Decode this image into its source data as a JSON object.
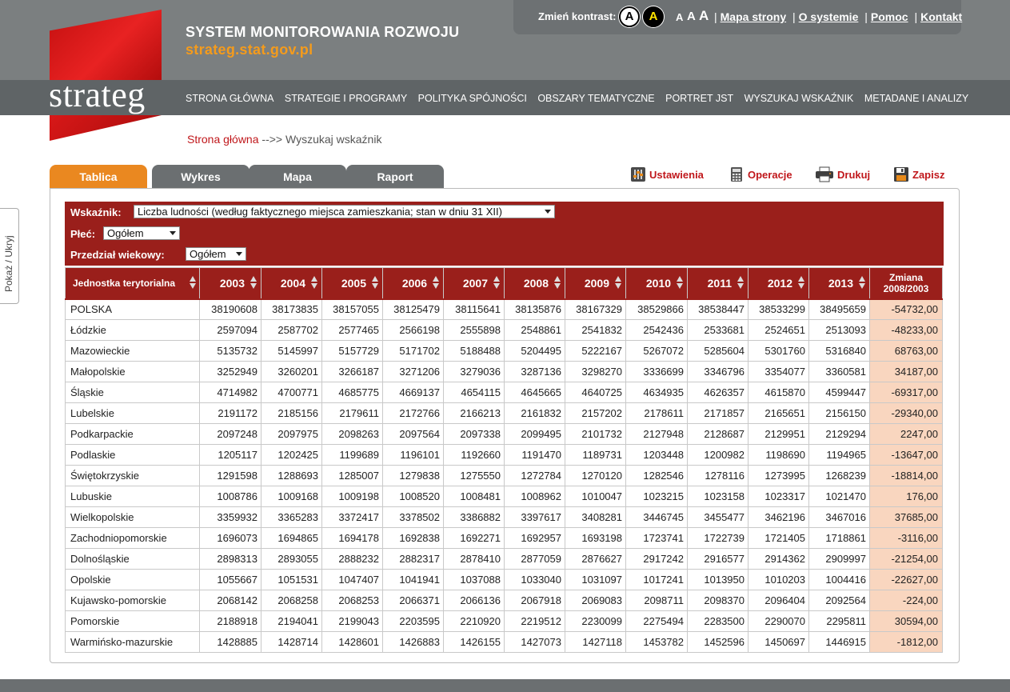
{
  "header": {
    "site_title": "SYSTEM MONITOROWANIA ROZWOJU",
    "site_url": "strateg.stat.gov.pl",
    "logo_text": "strateg",
    "contrast_label": "Zmień kontrast:",
    "contrast_normal": "A",
    "contrast_high": "A",
    "font_small": "A",
    "font_medium": "A",
    "font_large": "A",
    "links": [
      "Mapa strony",
      "O systemie",
      "Pomoc",
      "Kontakt"
    ],
    "link_separator": "|"
  },
  "nav": {
    "items": [
      "STRONA GŁÓWNA",
      "STRATEGIE I PROGRAMY",
      "POLITYKA SPÓJNOŚCI",
      "OBSZARY TEMATYCZNE",
      "PORTRET JST",
      "WYSZUKAJ WSKAŹNIK",
      "METADANE I ANALIZY"
    ]
  },
  "breadcrumb": {
    "home": "Strona główna",
    "separator": "-->>",
    "current": "Wyszukaj wskaźnik"
  },
  "side_toggle": "Pokaż / Ukryj",
  "tabs": [
    "Tablica",
    "Wykres",
    "Mapa",
    "Raport"
  ],
  "active_tab": "Tablica",
  "actions": {
    "settings": "Ustawienia",
    "operations": "Operacje",
    "print": "Drukuj",
    "save": "Zapisz"
  },
  "filters": {
    "indicator_label": "Wskaźnik:",
    "indicator_value": "Liczba ludności (według faktycznego miejsca zamieszkania; stan w dniu 31 XII)",
    "sex_label": "Płeć:",
    "sex_value": "Ogółem",
    "age_label": "Przedział wiekowy:",
    "age_value": "Ogółem"
  },
  "table": {
    "unit_header": "Jednostka terytorialna",
    "years": [
      "2003",
      "2004",
      "2005",
      "2006",
      "2007",
      "2008",
      "2009",
      "2010",
      "2011",
      "2012",
      "2013"
    ],
    "change_header_line1": "Zmiana",
    "change_header_line2": "2008/2003",
    "rows": [
      {
        "name": "POLSKA",
        "values": [
          "38190608",
          "38173835",
          "38157055",
          "38125479",
          "38115641",
          "38135876",
          "38167329",
          "38529866",
          "38538447",
          "38533299",
          "38495659"
        ],
        "change": "-54732,00"
      },
      {
        "name": "Łódzkie",
        "values": [
          "2597094",
          "2587702",
          "2577465",
          "2566198",
          "2555898",
          "2548861",
          "2541832",
          "2542436",
          "2533681",
          "2524651",
          "2513093"
        ],
        "change": "-48233,00"
      },
      {
        "name": "Mazowieckie",
        "values": [
          "5135732",
          "5145997",
          "5157729",
          "5171702",
          "5188488",
          "5204495",
          "5222167",
          "5267072",
          "5285604",
          "5301760",
          "5316840"
        ],
        "change": "68763,00"
      },
      {
        "name": "Małopolskie",
        "values": [
          "3252949",
          "3260201",
          "3266187",
          "3271206",
          "3279036",
          "3287136",
          "3298270",
          "3336699",
          "3346796",
          "3354077",
          "3360581"
        ],
        "change": "34187,00"
      },
      {
        "name": "Śląskie",
        "values": [
          "4714982",
          "4700771",
          "4685775",
          "4669137",
          "4654115",
          "4645665",
          "4640725",
          "4634935",
          "4626357",
          "4615870",
          "4599447"
        ],
        "change": "-69317,00"
      },
      {
        "name": "Lubelskie",
        "values": [
          "2191172",
          "2185156",
          "2179611",
          "2172766",
          "2166213",
          "2161832",
          "2157202",
          "2178611",
          "2171857",
          "2165651",
          "2156150"
        ],
        "change": "-29340,00"
      },
      {
        "name": "Podkarpackie",
        "values": [
          "2097248",
          "2097975",
          "2098263",
          "2097564",
          "2097338",
          "2099495",
          "2101732",
          "2127948",
          "2128687",
          "2129951",
          "2129294"
        ],
        "change": "2247,00"
      },
      {
        "name": "Podlaskie",
        "values": [
          "1205117",
          "1202425",
          "1199689",
          "1196101",
          "1192660",
          "1191470",
          "1189731",
          "1203448",
          "1200982",
          "1198690",
          "1194965"
        ],
        "change": "-13647,00"
      },
      {
        "name": "Świętokrzyskie",
        "values": [
          "1291598",
          "1288693",
          "1285007",
          "1279838",
          "1275550",
          "1272784",
          "1270120",
          "1282546",
          "1278116",
          "1273995",
          "1268239"
        ],
        "change": "-18814,00"
      },
      {
        "name": "Lubuskie",
        "values": [
          "1008786",
          "1009168",
          "1009198",
          "1008520",
          "1008481",
          "1008962",
          "1010047",
          "1023215",
          "1023158",
          "1023317",
          "1021470"
        ],
        "change": "176,00"
      },
      {
        "name": "Wielkopolskie",
        "values": [
          "3359932",
          "3365283",
          "3372417",
          "3378502",
          "3386882",
          "3397617",
          "3408281",
          "3446745",
          "3455477",
          "3462196",
          "3467016"
        ],
        "change": "37685,00"
      },
      {
        "name": "Zachodniopomorskie",
        "values": [
          "1696073",
          "1694865",
          "1694178",
          "1692838",
          "1692271",
          "1692957",
          "1693198",
          "1723741",
          "1722739",
          "1721405",
          "1718861"
        ],
        "change": "-3116,00"
      },
      {
        "name": "Dolnośląskie",
        "values": [
          "2898313",
          "2893055",
          "2888232",
          "2882317",
          "2878410",
          "2877059",
          "2876627",
          "2917242",
          "2916577",
          "2914362",
          "2909997"
        ],
        "change": "-21254,00"
      },
      {
        "name": "Opolskie",
        "values": [
          "1055667",
          "1051531",
          "1047407",
          "1041941",
          "1037088",
          "1033040",
          "1031097",
          "1017241",
          "1013950",
          "1010203",
          "1004416"
        ],
        "change": "-22627,00"
      },
      {
        "name": "Kujawsko-pomorskie",
        "values": [
          "2068142",
          "2068258",
          "2068253",
          "2066371",
          "2066136",
          "2067918",
          "2069083",
          "2098711",
          "2098370",
          "2096404",
          "2092564"
        ],
        "change": "-224,00"
      },
      {
        "name": "Pomorskie",
        "values": [
          "2188918",
          "2194041",
          "2199043",
          "2203595",
          "2210920",
          "2219512",
          "2230099",
          "2275494",
          "2283500",
          "2290070",
          "2295811"
        ],
        "change": "30594,00"
      },
      {
        "name": "Warmińsko-mazurskie",
        "values": [
          "1428885",
          "1428714",
          "1428601",
          "1426883",
          "1426155",
          "1427073",
          "1427118",
          "1453782",
          "1452596",
          "1450697",
          "1446915"
        ],
        "change": "-1812,00"
      }
    ]
  },
  "colors": {
    "brand_red": "#9a1f1b",
    "accent_orange": "#ea8820",
    "link_red": "#c0171b",
    "change_cell": "#f9d6bf"
  }
}
